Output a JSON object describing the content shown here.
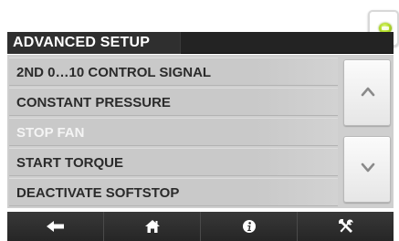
{
  "header": {
    "title": "ADVANCED SETUP"
  },
  "status": {
    "icon": "status-led-icon",
    "color": "#b6df2e"
  },
  "menu": {
    "items": [
      {
        "label": "2ND 0…10 CONTROL SIGNAL",
        "dimmed": false
      },
      {
        "label": "CONSTANT PRESSURE",
        "dimmed": false
      },
      {
        "label": "STOP FAN",
        "dimmed": true
      },
      {
        "label": "START TORQUE",
        "dimmed": false
      },
      {
        "label": "DEACTIVATE SOFTSTOP",
        "dimmed": false
      }
    ]
  },
  "scroll": {
    "up_icon": "chevron-up-icon",
    "down_icon": "chevron-down-icon"
  },
  "nav": {
    "items": [
      {
        "icon": "back-arrow-icon"
      },
      {
        "icon": "home-icon"
      },
      {
        "icon": "info-icon"
      },
      {
        "icon": "tools-icon"
      }
    ]
  }
}
